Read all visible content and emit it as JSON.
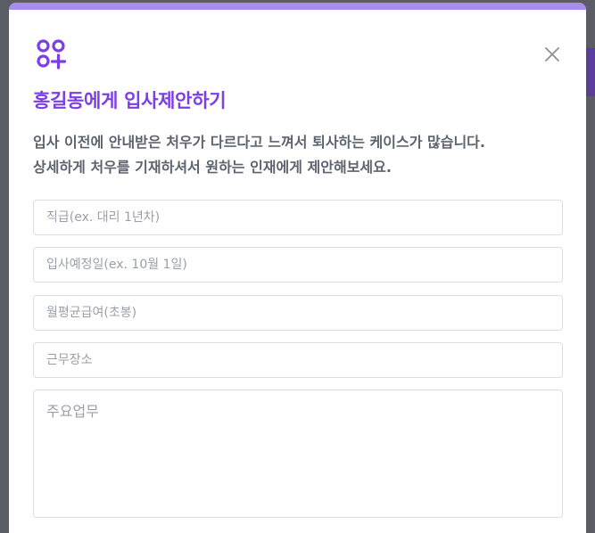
{
  "modal": {
    "title": "홍길동에게 입사제안하기",
    "description_lines": [
      "입사 이전에 안내받은 처우가 다르다고 느껴서 퇴사하는 케이스가 많습니다.",
      "상세하게 처우를 기재하셔서 원하는 인재에게 제안해보세요."
    ],
    "fields": {
      "position": {
        "placeholder": "직급(ex. 대리 1년차)",
        "value": ""
      },
      "start_date": {
        "placeholder": "입사예정일(ex. 10월 1일)",
        "value": ""
      },
      "salary": {
        "placeholder": "월평균급여(초봉)",
        "value": ""
      },
      "location": {
        "placeholder": "근무장소",
        "value": ""
      },
      "duties": {
        "placeholder": "주요업무",
        "value": ""
      }
    }
  },
  "icons": {
    "logo": "logo-icon",
    "close": "close-icon"
  },
  "colors": {
    "accent": "#7b3fe4",
    "top_bar": "#a98cf0",
    "text_muted": "#5d6470",
    "border": "#dcdde2",
    "overlay": "#5b5d66"
  }
}
